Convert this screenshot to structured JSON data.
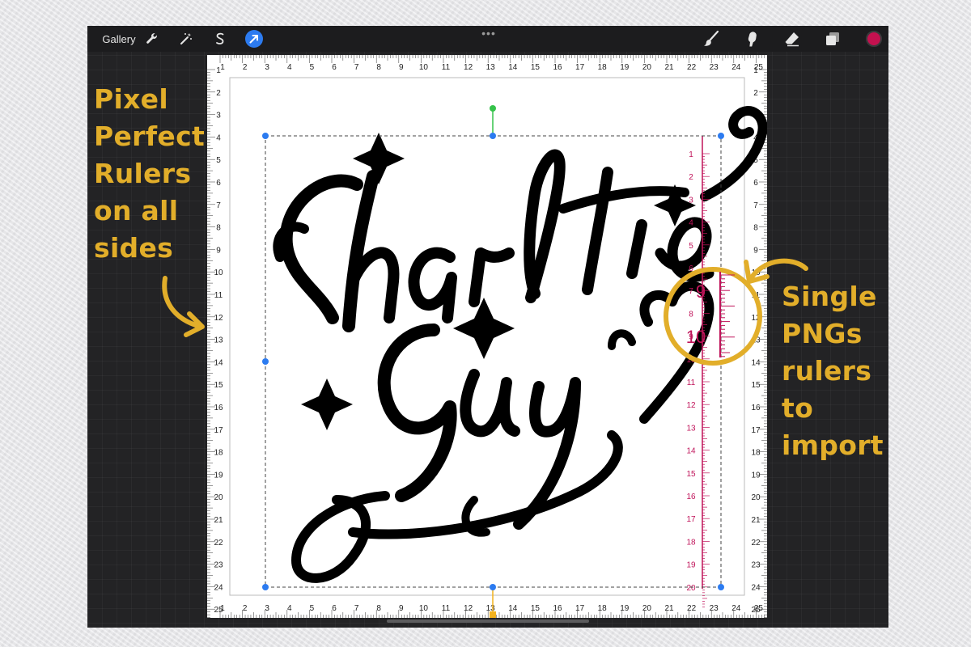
{
  "app": {
    "gallery_label": "Gallery",
    "tools_left": [
      "wrench-icon",
      "magic-wand-icon",
      "selection-s-icon",
      "transform-arrow-icon"
    ],
    "tools_right": [
      "brush-icon",
      "smudge-icon",
      "eraser-icon",
      "layers-icon"
    ],
    "more_label": "•••",
    "active_color": "#c4114f",
    "accent_color": "#2c7bf0"
  },
  "canvas": {
    "artwork_text_line1": "Charlie",
    "artwork_text_line2": "Guy",
    "ruler_top_labels": [
      "1",
      "2",
      "3",
      "4",
      "5",
      "6",
      "7",
      "8",
      "9",
      "10",
      "11",
      "12",
      "13",
      "14",
      "15",
      "16",
      "17",
      "18",
      "19",
      "20",
      "21",
      "22",
      "23",
      "24",
      "25"
    ],
    "ruler_bottom_labels": [
      "1",
      "2",
      "3",
      "4",
      "5",
      "6",
      "7",
      "8",
      "9",
      "10",
      "11",
      "12",
      "13",
      "14",
      "15",
      "16",
      "17",
      "18",
      "19",
      "20",
      "21",
      "22",
      "23",
      "24",
      "25"
    ],
    "ruler_left_labels": [
      "1",
      "2",
      "3",
      "4",
      "5",
      "6",
      "7",
      "8",
      "9",
      "10",
      "11",
      "12",
      "13",
      "14",
      "15",
      "16",
      "17",
      "18",
      "19",
      "20",
      "21",
      "22",
      "23",
      "24",
      "25"
    ],
    "ruler_right_labels": [
      "1",
      "2",
      "3",
      "4",
      "5",
      "6",
      "7",
      "8",
      "9",
      "10",
      "11",
      "12",
      "13",
      "14",
      "15",
      "16",
      "17",
      "18",
      "19",
      "20",
      "21",
      "22",
      "23",
      "24",
      "25"
    ],
    "pink_ruler_labels": [
      "1",
      "2",
      "3",
      "4",
      "5",
      "6",
      "7",
      "8",
      "9",
      "10",
      "11",
      "12",
      "13",
      "14",
      "15",
      "16",
      "17",
      "18",
      "19",
      "20"
    ],
    "pink_ruler_zoom_labels": [
      "9",
      "10"
    ],
    "pink_color": "#c0145a",
    "selection_color": "#2c7bf0",
    "rotate_handle_color": "#35c24a",
    "snap_handle_color": "#f3b21e"
  },
  "callouts": {
    "left_lines": [
      "Pixel",
      "Perfect",
      "Rulers",
      "on all",
      "sides"
    ],
    "right_lines": [
      "Single",
      "PNGs",
      "rulers",
      "to",
      "import"
    ],
    "color": "#e2ae2a"
  }
}
